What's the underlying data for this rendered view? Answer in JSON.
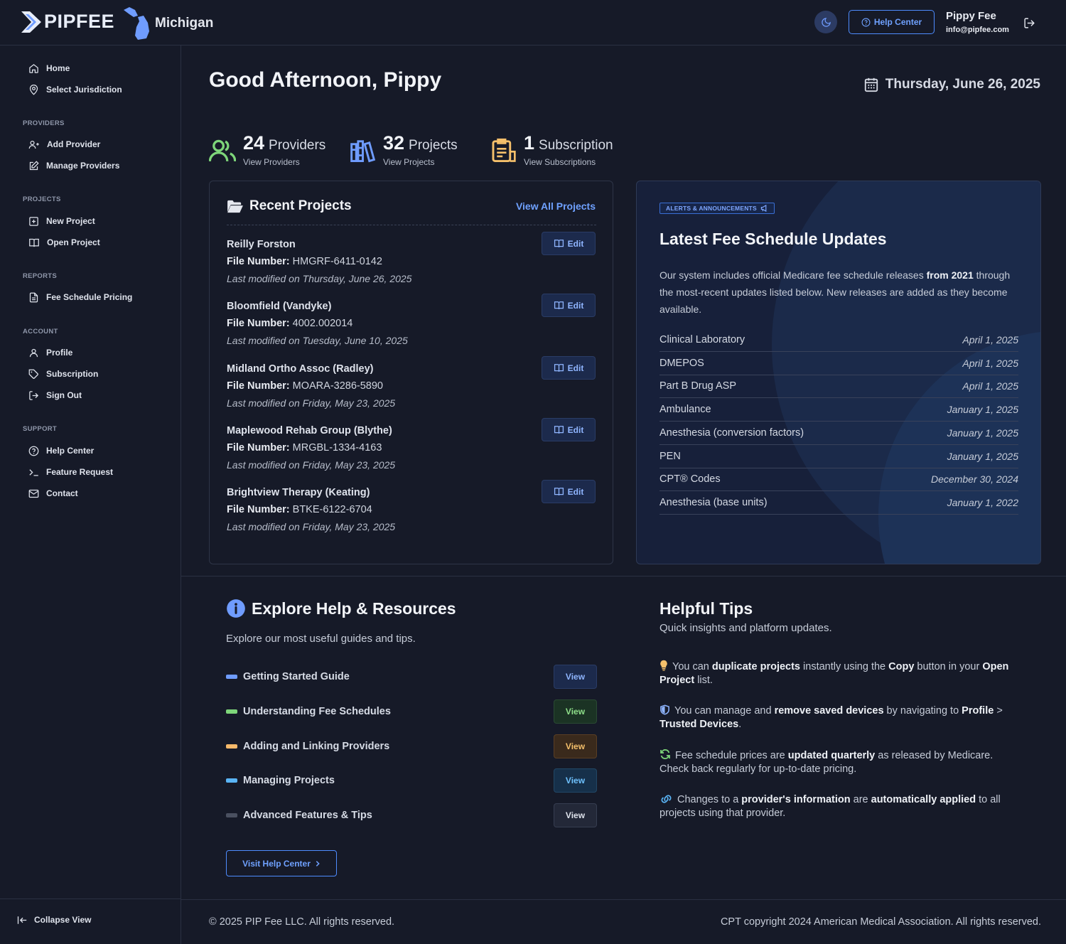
{
  "header": {
    "brand": "PIPFEE",
    "jurisdiction": "Michigan",
    "help_center": "Help Center",
    "user_name": "Pippy Fee",
    "user_email": "info@pipfee.com"
  },
  "sidebar": {
    "top": [
      {
        "label": "Home",
        "icon": "home-icon"
      },
      {
        "label": "Select Jurisdiction",
        "icon": "map-pin-icon"
      }
    ],
    "providers_heading": "PROVIDERS",
    "providers": [
      {
        "label": "Add Provider",
        "icon": "user-plus-icon"
      },
      {
        "label": "Manage Providers",
        "icon": "edit-square-icon"
      }
    ],
    "projects_heading": "PROJECTS",
    "projects": [
      {
        "label": "New Project",
        "icon": "plus-square-icon"
      },
      {
        "label": "Open Project",
        "icon": "book-open-icon"
      }
    ],
    "reports_heading": "REPORTS",
    "reports": [
      {
        "label": "Fee Schedule Pricing",
        "icon": "document-icon"
      }
    ],
    "account_heading": "ACCOUNT",
    "account": [
      {
        "label": "Profile",
        "icon": "user-icon"
      },
      {
        "label": "Subscription",
        "icon": "tag-icon"
      },
      {
        "label": "Sign Out",
        "icon": "sign-out-icon"
      }
    ],
    "support_heading": "SUPPORT",
    "support": [
      {
        "label": "Help Center",
        "icon": "help-circle-icon"
      },
      {
        "label": "Feature Request",
        "icon": "terminal-icon"
      },
      {
        "label": "Contact",
        "icon": "mail-icon"
      }
    ],
    "collapse": "Collapse View"
  },
  "main": {
    "greeting": "Good Afternoon, Pippy",
    "date": "Thursday, June 26, 2025",
    "stats": [
      {
        "count": "24",
        "label": "Providers",
        "link": "View Providers",
        "color": "#7ed67a"
      },
      {
        "count": "32",
        "label": "Projects",
        "link": "View Projects",
        "color": "#6f9cff"
      },
      {
        "count": "1",
        "label": "Subscription",
        "link": "View Subscriptions",
        "color": "#f5c06b"
      }
    ]
  },
  "recent_projects": {
    "title": "Recent Projects",
    "view_all": "View All Projects",
    "file_label": "File Number:",
    "edit_label": "Edit",
    "items": [
      {
        "name": "Reilly Forston",
        "file": "HMGRF-6411-0142",
        "modified": "Last modified on Thursday, June 26, 2025"
      },
      {
        "name": "Bloomfield (Vandyke)",
        "file": "4002.002014",
        "modified": "Last modified on Tuesday, June 10, 2025"
      },
      {
        "name": "Midland Ortho Assoc (Radley)",
        "file": "MOARA-3286-5890",
        "modified": "Last modified on Friday, May 23, 2025"
      },
      {
        "name": "Maplewood Rehab Group (Blythe)",
        "file": "MRGBL-1334-4163",
        "modified": "Last modified on Friday, May 23, 2025"
      },
      {
        "name": "Brightview Therapy (Keating)",
        "file": "BTKE-6122-6704",
        "modified": "Last modified on Friday, May 23, 2025"
      }
    ]
  },
  "alerts": {
    "badge": "ALERTS & ANNOUNCEMENTS",
    "title": "Latest Fee Schedule Updates",
    "intro_a": "Our system includes official Medicare fee schedule releases ",
    "intro_b": "from 2021",
    "intro_c": " through the most-recent updates listed below. New releases are added as they become available.",
    "updates": [
      {
        "name": "Clinical Laboratory",
        "date": "April 1, 2025"
      },
      {
        "name": "DMEPOS",
        "date": "April 1, 2025"
      },
      {
        "name": "Part B Drug ASP",
        "date": "April 1, 2025"
      },
      {
        "name": "Ambulance",
        "date": "January 1, 2025"
      },
      {
        "name": "Anesthesia (conversion factors)",
        "date": "January 1, 2025"
      },
      {
        "name": "PEN",
        "date": "January 1, 2025"
      },
      {
        "name": "CPT® Codes",
        "date": "December 30, 2024"
      },
      {
        "name": "Anesthesia (base units)",
        "date": "January 1, 2022"
      }
    ]
  },
  "resources": {
    "title": "Explore Help & Resources",
    "subtitle": "Explore our most useful guides and tips.",
    "view_label": "View",
    "items": [
      {
        "label": "Getting Started Guide",
        "color": "#6f9cff"
      },
      {
        "label": "Understanding Fee Schedules",
        "color": "#7ed67a"
      },
      {
        "label": "Adding and Linking Providers",
        "color": "#f5b96b"
      },
      {
        "label": "Managing Projects",
        "color": "#5ab4f5"
      },
      {
        "label": "Advanced Features & Tips",
        "color": "#4a5060"
      }
    ],
    "visit": "Visit Help Center"
  },
  "tips": {
    "title": "Helpful Tips",
    "subtitle": "Quick insights and platform updates.",
    "t1": [
      "You can ",
      "duplicate projects",
      " instantly using the ",
      "Copy",
      " button in your ",
      "Open Project",
      " list."
    ],
    "t2": [
      "You can manage and ",
      "remove saved devices",
      " by navigating to ",
      "Profile",
      " > ",
      "Trusted Devices",
      "."
    ],
    "t3": [
      "Fee schedule prices are ",
      "updated quarterly",
      " as released by Medicare. Check back regularly for up-to-date pricing."
    ],
    "t4": [
      "Changes to a ",
      "provider's information",
      " are ",
      "automatically applied",
      " to all projects using that provider."
    ]
  },
  "footer": {
    "copyright": "© 2025 PIP Fee LLC. All rights reserved.",
    "cpt": "CPT copyright 2024 American Medical Association. All rights reserved."
  }
}
